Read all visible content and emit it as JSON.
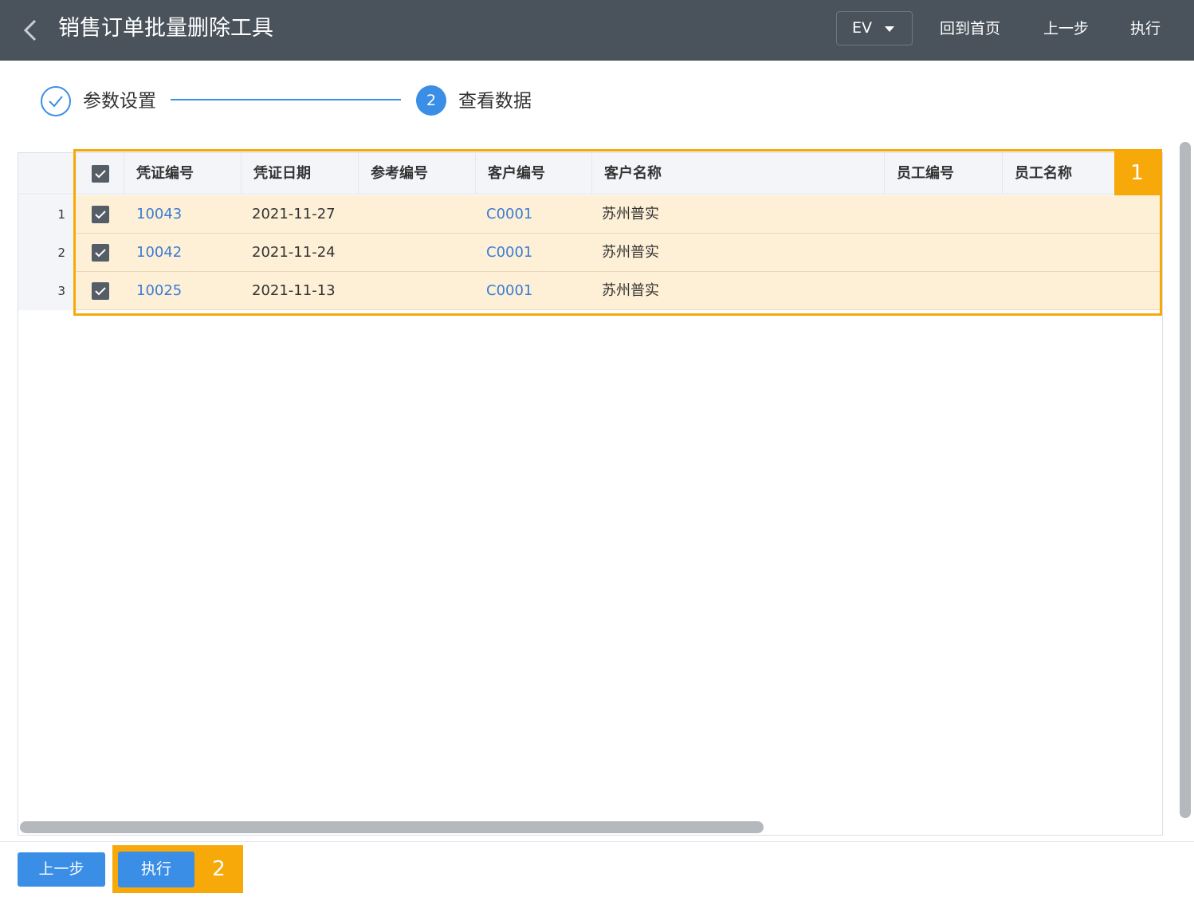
{
  "header": {
    "title": "销售订单批量删除工具",
    "env_label": "EV",
    "home_label": "回到首页",
    "prev_label": "上一步",
    "run_label": "执行"
  },
  "steps": [
    {
      "label": "参数设置",
      "status": "done"
    },
    {
      "label": "查看数据",
      "number": "2",
      "status": "active"
    }
  ],
  "table": {
    "columns": [
      "凭证编号",
      "凭证日期",
      "参考编号",
      "客户编号",
      "客户名称",
      "员工编号",
      "员工名称"
    ],
    "rows": [
      {
        "num": "1",
        "checked": true,
        "voucher_no": "10043",
        "date": "2021-11-27",
        "ref_no": "",
        "customer_no": "C0001",
        "customer_name": "苏州普实",
        "employee_no": "",
        "employee_name": ""
      },
      {
        "num": "2",
        "checked": true,
        "voucher_no": "10042",
        "date": "2021-11-24",
        "ref_no": "",
        "customer_no": "C0001",
        "customer_name": "苏州普实",
        "employee_no": "",
        "employee_name": ""
      },
      {
        "num": "3",
        "checked": true,
        "voucher_no": "10025",
        "date": "2021-11-13",
        "ref_no": "",
        "customer_no": "C0001",
        "customer_name": "苏州普实",
        "employee_no": "",
        "employee_name": ""
      }
    ]
  },
  "footer": {
    "prev_label": "上一步",
    "run_label": "执行"
  },
  "annotations": [
    "1",
    "2"
  ],
  "colors": {
    "header_bg": "#4a535c",
    "accent": "#3a8ee6",
    "highlight": "#f7a90a",
    "selected_row": "#fdf0d6",
    "link": "#3a7bd5"
  }
}
